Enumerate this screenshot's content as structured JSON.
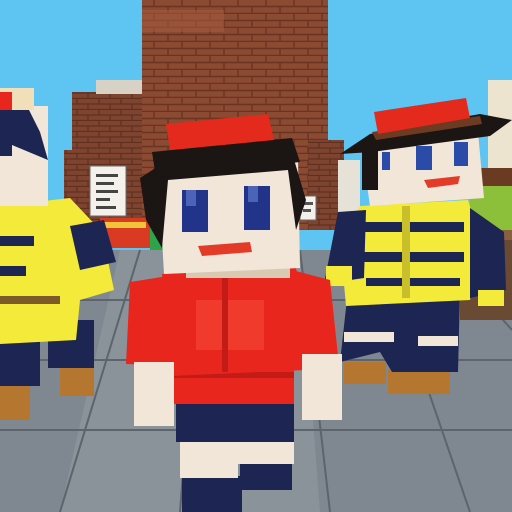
{
  "scene": {
    "description_type": "blocky-3d-game-screenshot",
    "colors": {
      "sky": "#5ec4f2",
      "brick": "#8b4a32",
      "brick_dark": "#6a3422",
      "floor": "#7f8890",
      "floor_line": "#5d646b",
      "shirt_red": "#e8261e",
      "hat_red": "#e32a1c",
      "jacket_yellow": "#f3ea3a",
      "uniform_navy": "#1d2552",
      "skin": "#f1e6d8",
      "hair_black": "#1b1514",
      "boots_brown": "#b5772f",
      "grass": "#8cbf3a"
    }
  },
  "characters": [
    {
      "name": "center-character",
      "role": "player",
      "hat": "red-cap",
      "outfit": "red-shirt-navy-pants"
    },
    {
      "name": "right-character",
      "role": "npc",
      "hat": "red-cowboy-hat",
      "outfit": "yellow-jacket-navy-stripes"
    },
    {
      "name": "left-character",
      "role": "npc",
      "hat": "navy-cap",
      "outfit": "yellow-jacket-navy-stripes"
    }
  ]
}
